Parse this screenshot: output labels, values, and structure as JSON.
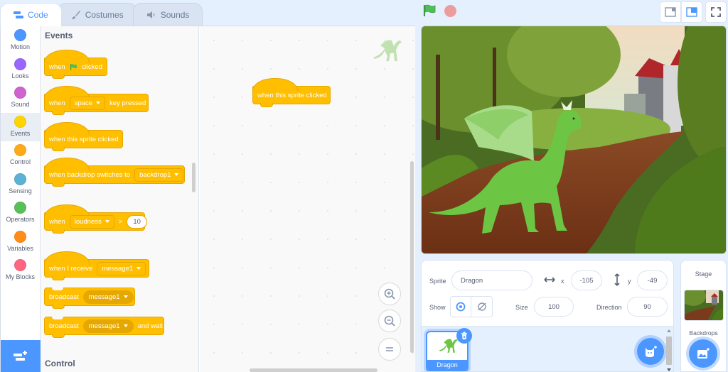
{
  "tabs": [
    {
      "label": "Code",
      "icon": "code-icon",
      "active": true
    },
    {
      "label": "Costumes",
      "icon": "brush-icon",
      "active": false
    },
    {
      "label": "Sounds",
      "icon": "speaker-icon",
      "active": false
    }
  ],
  "categories": [
    {
      "label": "Motion",
      "color": "#4c97ff"
    },
    {
      "label": "Looks",
      "color": "#9966ff"
    },
    {
      "label": "Sound",
      "color": "#cf63cf"
    },
    {
      "label": "Events",
      "color": "#ffd500",
      "active": true
    },
    {
      "label": "Control",
      "color": "#ffab19"
    },
    {
      "label": "Sensing",
      "color": "#5cb1d6"
    },
    {
      "label": "Operators",
      "color": "#59c059"
    },
    {
      "label": "Variables",
      "color": "#ff8c1a"
    },
    {
      "label": "My Blocks",
      "color": "#ff6680"
    }
  ],
  "palette": {
    "section_title": "Events",
    "next_section_title": "Control",
    "blocks": {
      "flag_clicked": {
        "when": "when",
        "clicked": "clicked"
      },
      "key_pressed": {
        "when": "when",
        "key": "space",
        "suffix": "key pressed"
      },
      "sprite_clicked": {
        "label": "when this sprite clicked"
      },
      "backdrop_switch": {
        "label": "when backdrop switches to",
        "value": "backdrop1"
      },
      "loudness": {
        "when": "when",
        "sensor": "loudness",
        "op": ">",
        "value": "10"
      },
      "receive": {
        "label": "when I receive",
        "value": "message1"
      },
      "broadcast": {
        "label": "broadcast",
        "value": "message1"
      },
      "broadcast_wait": {
        "label": "broadcast",
        "value": "message1",
        "suffix": "and wait"
      }
    }
  },
  "workspace": {
    "script_block": "when this sprite clicked"
  },
  "sprite_info": {
    "sprite_label": "Sprite",
    "sprite_name": "Dragon",
    "x_label": "x",
    "x_value": "-105",
    "y_label": "y",
    "y_value": "-49",
    "show_label": "Show",
    "size_label": "Size",
    "size_value": "100",
    "direction_label": "Direction",
    "direction_value": "90"
  },
  "sprites": [
    {
      "name": "Dragon",
      "selected": true
    }
  ],
  "stage_pane": {
    "title": "Stage",
    "backdrops_label": "Backdrops"
  },
  "colors": {
    "accent": "#4c97ff",
    "events": "#ffbf00",
    "flag": "#4cbf56",
    "stop": "#ec9c9c"
  }
}
